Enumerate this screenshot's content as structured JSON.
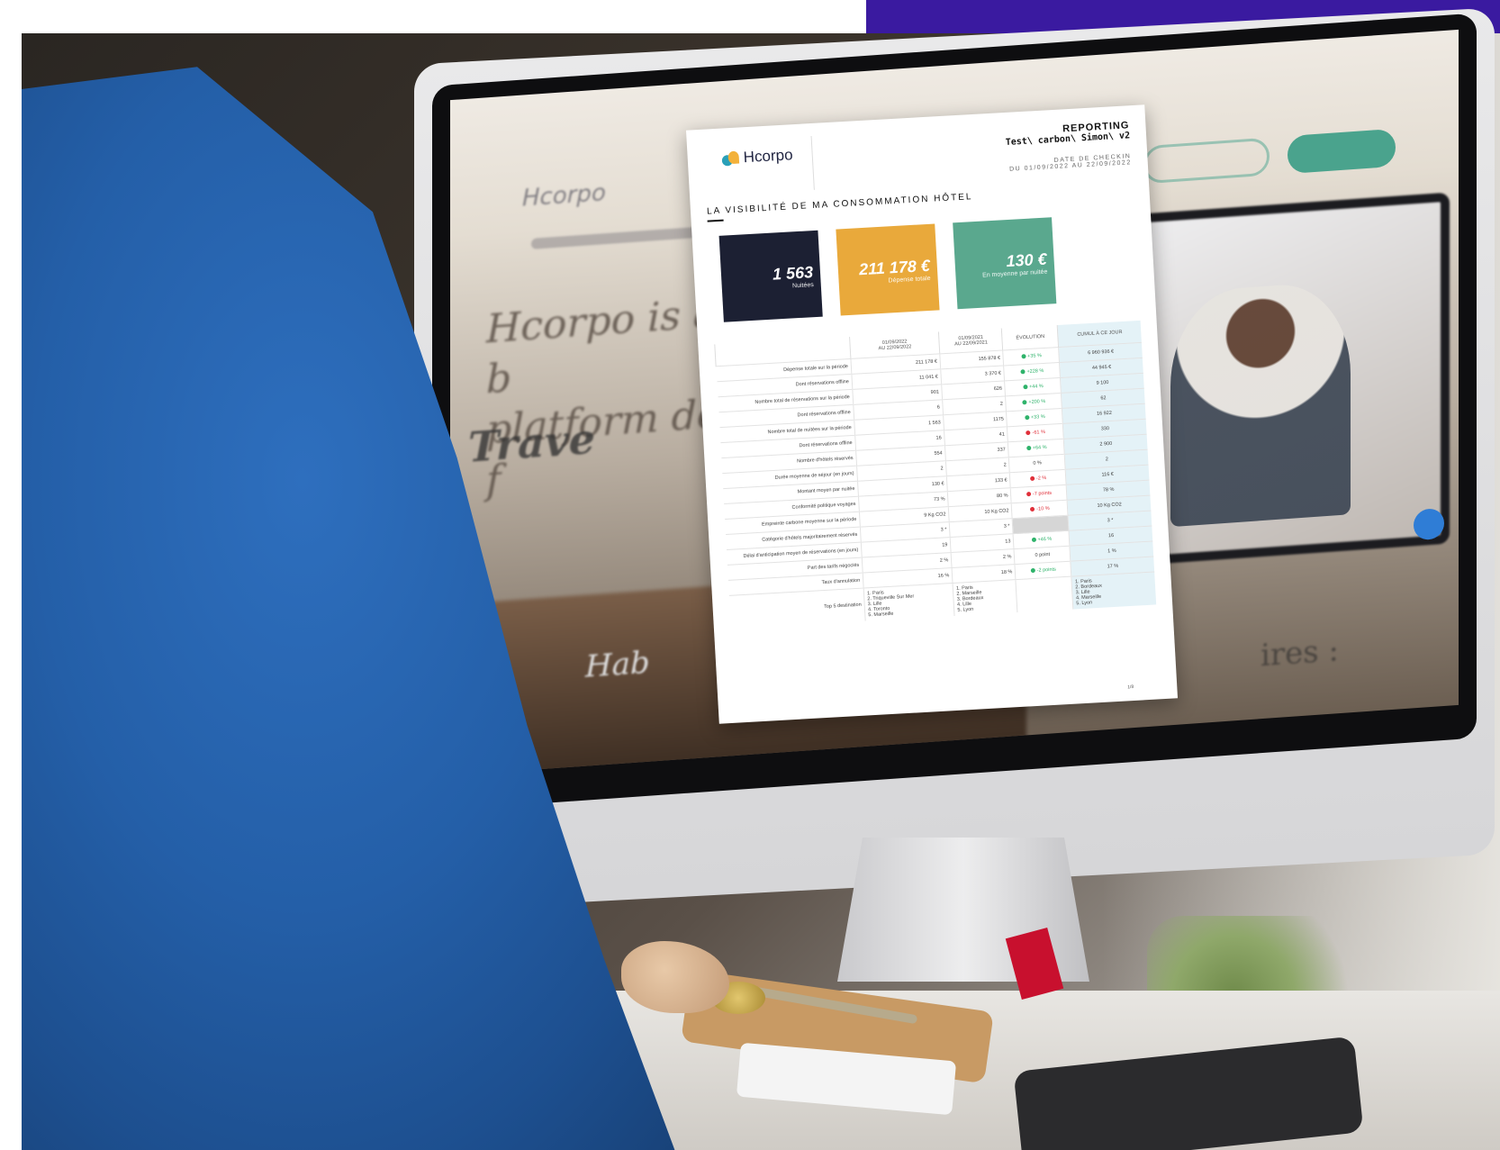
{
  "scene": {
    "description_colors": {
      "top_bar": "#3a1aa0",
      "brand_teal": "#4aa38d"
    }
  },
  "background_website": {
    "logo": "Hcorpo",
    "headline": "Hcorpo is a hotel b\nplatform designed f",
    "subheadline": "Trave",
    "bottom_text": "Hab",
    "bottom_right_text": "ires :"
  },
  "report": {
    "logo": "Hcorpo",
    "title": "REPORTING",
    "subtitle": "Test\\ carbon\\ Simon\\ v2",
    "date_label": "DATE DE CHECKIN",
    "date_range": "DU 01/09/2022 AU 22/09/2022",
    "section_title": "LA VISIBILITÉ DE MA CONSOMMATION HÔTEL",
    "kpis": [
      {
        "value": "1 563",
        "label": "Nuitées",
        "color": "#1c2033"
      },
      {
        "value": "211 178 €",
        "label": "Dépense totale",
        "color": "#e9a93b"
      },
      {
        "value": "130 €",
        "label": "En moyenne par nuitée",
        "color": "#5aa88e"
      }
    ],
    "table": {
      "headers": [
        "",
        "01/09/2022\nAU 22/09/2022",
        "01/09/2021\nAU 22/09/2021",
        "ÉVOLUTION",
        "CUMUL À CE JOUR"
      ],
      "rows": [
        {
          "label": "Dépense totale sur la période",
          "cur": "211 178 €",
          "prev": "155 878 €",
          "evo": "+35 %",
          "evo_dir": "up",
          "cum": "6 960 936 €"
        },
        {
          "label": "Dont réservations offline",
          "cur": "11 041 €",
          "prev": "3 370 €",
          "evo": "+228 %",
          "evo_dir": "up",
          "cum": "44 945 €"
        },
        {
          "label": "Nombre total de réservations sur la période",
          "cur": "901",
          "prev": "626",
          "evo": "+44 %",
          "evo_dir": "up",
          "cum": "9 100"
        },
        {
          "label": "Dont réservations offline",
          "cur": "6",
          "prev": "2",
          "evo": "+200 %",
          "evo_dir": "up",
          "cum": "62"
        },
        {
          "label": "Nombre total de nuitées sur la période",
          "cur": "1 563",
          "prev": "1175",
          "evo": "+33 %",
          "evo_dir": "up",
          "cum": "16 922"
        },
        {
          "label": "Dont réservations offline",
          "cur": "16",
          "prev": "41",
          "evo": "-61 %",
          "evo_dir": "down",
          "cum": "330"
        },
        {
          "label": "Nombre d'hôtels réservés",
          "cur": "554",
          "prev": "337",
          "evo": "+64 %",
          "evo_dir": "up",
          "cum": "2 900"
        },
        {
          "label": "Durée moyenne de séjour (en jours)",
          "cur": "2",
          "prev": "2",
          "evo": "0 %",
          "evo_dir": "",
          "cum": "2"
        },
        {
          "label": "Montant moyen par nuitée",
          "cur": "130 €",
          "prev": "133 €",
          "evo": "-2 %",
          "evo_dir": "down",
          "cum": "116 €"
        },
        {
          "label": "Conformité politique voyages",
          "cur": "73 %",
          "prev": "80 %",
          "evo": "-7 points",
          "evo_dir": "down",
          "cum": "78 %"
        },
        {
          "label": "Empreinte carbone moyenne sur la période",
          "cur": "9 Kg CO2",
          "prev": "10 Kg CO2",
          "evo": "-10 %",
          "evo_dir": "down",
          "cum": "10 Kg CO2"
        },
        {
          "label": "Catégorie d'hôtels majoritairement réservés",
          "cur": "3 *",
          "prev": "3 *",
          "evo": "",
          "evo_dir": "gray",
          "cum": "3 *"
        },
        {
          "label": "Délai d'anticipation moyen de réservations (en jours)",
          "cur": "19",
          "prev": "13",
          "evo": "+46 %",
          "evo_dir": "up",
          "cum": "16"
        },
        {
          "label": "Part des tarifs négociés",
          "cur": "2 %",
          "prev": "2 %",
          "evo": "0 point",
          "evo_dir": "",
          "cum": "1 %"
        },
        {
          "label": "Taux d'annulation",
          "cur": "16 %",
          "prev": "18 %",
          "evo": "-2 points",
          "evo_dir": "up",
          "cum": "17 %"
        },
        {
          "label": "Top 5 destination",
          "cur": "1. Paris\n2. Triqueville Sur Mer\n3. Lille\n4. Toronto\n5. Marseille",
          "prev": "1. Paris\n2. Marseille\n3. Bordeaux\n4. Lille\n5. Lyon",
          "evo": "",
          "evo_dir": "",
          "cum": "1. Paris\n2. Bordeaux\n3. Lille\n4. Marseille\n5. Lyon"
        }
      ]
    },
    "page_number": "1/8"
  }
}
